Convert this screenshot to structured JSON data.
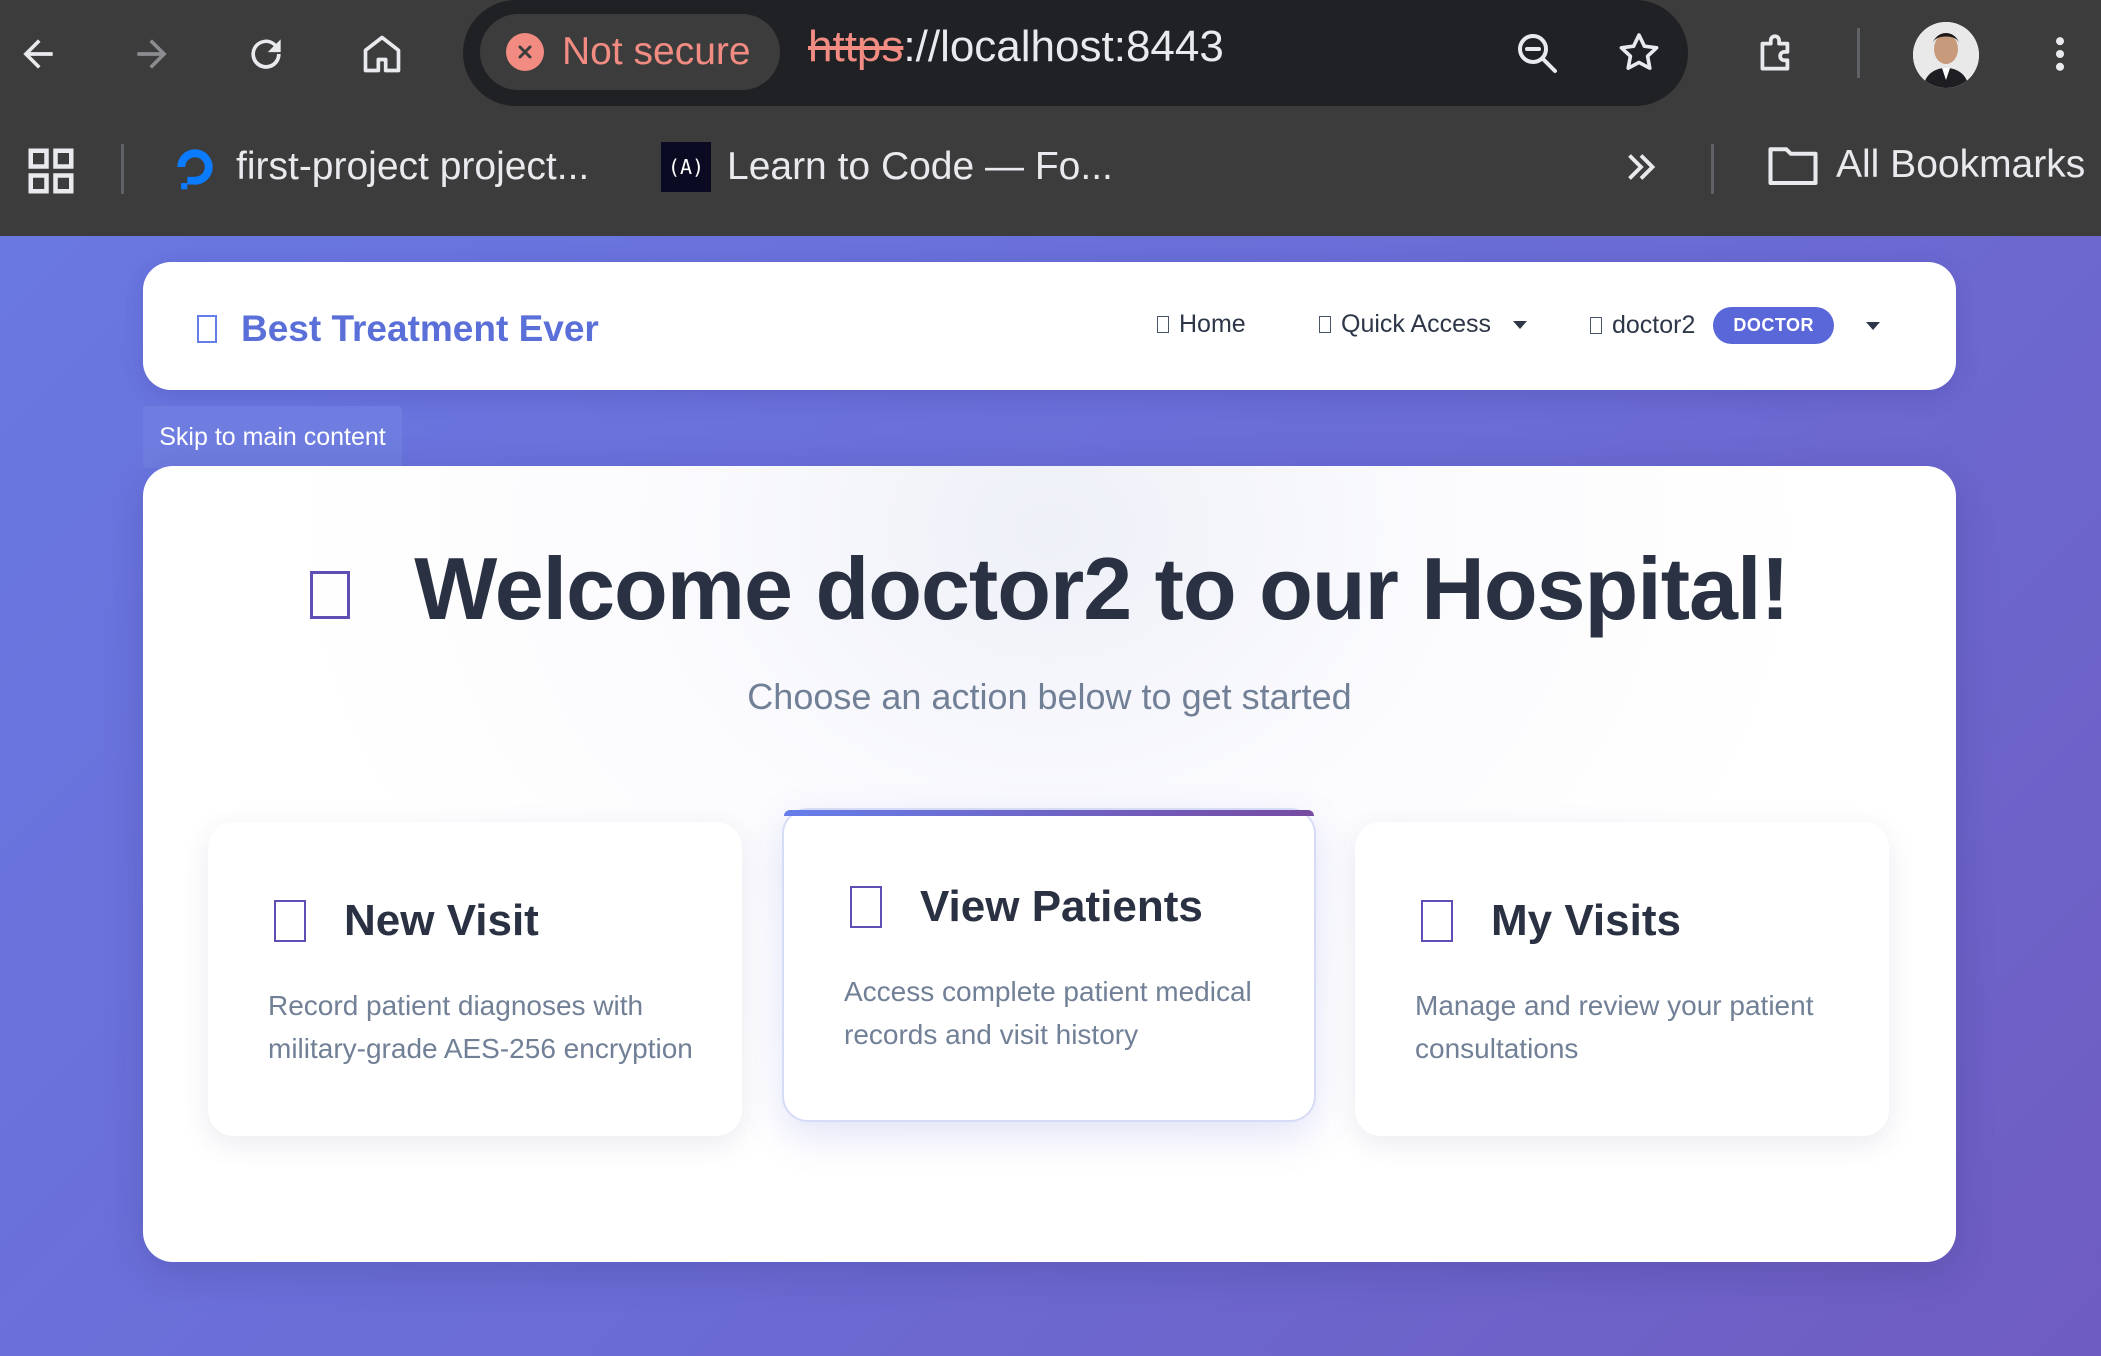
{
  "browser": {
    "security_label": "Not secure",
    "url_scheme": "https",
    "url_rest": "://localhost:8443",
    "bookmarks": [
      {
        "label": "first-project project..."
      },
      {
        "label": "Learn to Code — Fo..."
      }
    ],
    "all_bookmarks_label": "All Bookmarks",
    "colors": {
      "chrome_bg": "#3c3c3c",
      "omnibox_bg": "#202124",
      "warning": "#f28b82"
    }
  },
  "navbar": {
    "brand": "Best Treatment Ever",
    "home_label": "Home",
    "quick_access_label": "Quick Access",
    "user_label": "doctor2",
    "role_badge": "DOCTOR"
  },
  "skip_link": "Skip to main content",
  "hero": {
    "title": "Welcome doctor2 to our Hospital!",
    "subtitle": "Choose an action below to get started"
  },
  "cards": [
    {
      "title": "New Visit",
      "description": "Record patient diagnoses with military-grade AES-256 encryption"
    },
    {
      "title": "View Patients",
      "description": "Access complete patient medical records and visit history",
      "active": true
    },
    {
      "title": "My Visits",
      "description": "Manage and review your patient consultations"
    }
  ],
  "colors": {
    "accent": "#667eea",
    "accent_dark": "#764ba2",
    "badge": "#5a67d8",
    "heading": "#2a3142",
    "muted": "#718096"
  }
}
